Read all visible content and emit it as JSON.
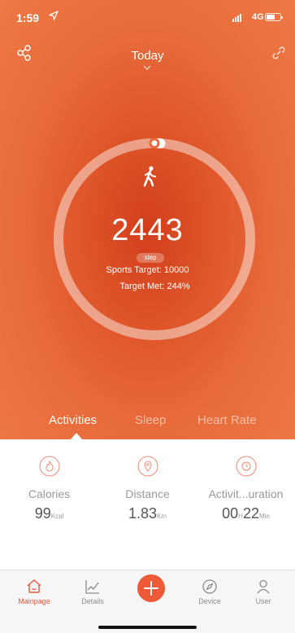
{
  "status_bar": {
    "time": "1:59",
    "network": "4G"
  },
  "header": {
    "date_label": "Today"
  },
  "ring": {
    "progress": 0.01,
    "steps": "2443",
    "unit_badge": "step",
    "sports_target": "Sports Target: 10000",
    "target_met": "Target Met: 244%"
  },
  "tabs": [
    {
      "label": "Activities",
      "active": true
    },
    {
      "label": "Sleep",
      "active": false
    },
    {
      "label": "Heart Rate",
      "active": false
    }
  ],
  "metrics": [
    {
      "icon": "flame-icon",
      "label": "Calories",
      "value": "99",
      "unit": "Kcal"
    },
    {
      "icon": "location-pin-icon",
      "label": "Distance",
      "value": "1.83",
      "unit": "Km"
    },
    {
      "icon": "clock-icon",
      "label": "Activit...uration",
      "value_hours": "00",
      "unit_hours": "H",
      "value_minutes": "22",
      "unit_minutes": "Min"
    }
  ],
  "nav": [
    {
      "label": "Mainpage",
      "icon": "home-icon",
      "active": true
    },
    {
      "label": "Details",
      "icon": "chart-icon",
      "active": false
    },
    {
      "label": "",
      "icon": "plus-icon",
      "active": false
    },
    {
      "label": "Device",
      "icon": "compass-icon",
      "active": false
    },
    {
      "label": "User",
      "icon": "user-icon",
      "active": false
    }
  ],
  "colors": {
    "accent": "#ee5a37",
    "hero_dark": "#d23e1c",
    "hero_light": "#ee7a46",
    "icon_outline": "#f08a78"
  }
}
